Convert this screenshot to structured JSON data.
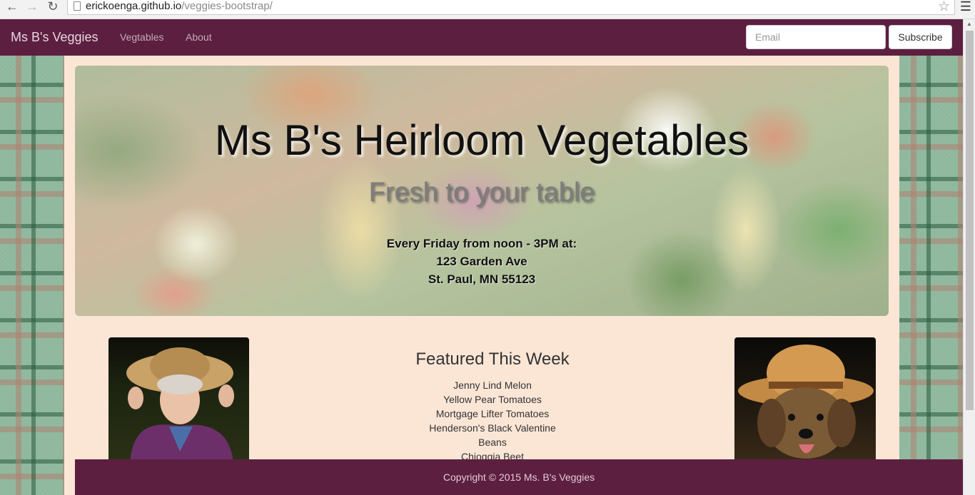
{
  "browser": {
    "url_host": "erickoenga.github.io",
    "url_path": "/veggies-bootstrap/"
  },
  "navbar": {
    "brand": "Ms B's Veggies",
    "links": [
      "Vegtables",
      "About"
    ],
    "email_placeholder": "Email",
    "subscribe_label": "Subscribe"
  },
  "jumbotron": {
    "title": "Ms B's Heirloom Vegetables",
    "subtitle": "Fresh to your table",
    "info_lines": [
      "Every Friday from noon - 3PM at:",
      "123 Garden Ave",
      "St. Paul, MN 55123"
    ]
  },
  "featured": {
    "title": "Featured This Week",
    "items": [
      "Jenny Lind Melon",
      "Yellow Pear Tomatoes",
      "Mortgage Lifter Tomatoes",
      "Henderson's Black Valentine",
      "Beans",
      "Chioggia Beet"
    ]
  },
  "footer": {
    "text": "Copyright © 2015 Ms. B's Veggies"
  },
  "colors": {
    "navbar_bg": "#5c1f40",
    "page_bg": "#fbe6d6",
    "plaid_green": "#8db79c"
  },
  "icons": [
    "back-arrow-icon",
    "forward-arrow-icon",
    "reload-icon",
    "page-icon",
    "star-icon",
    "menu-icon"
  ]
}
